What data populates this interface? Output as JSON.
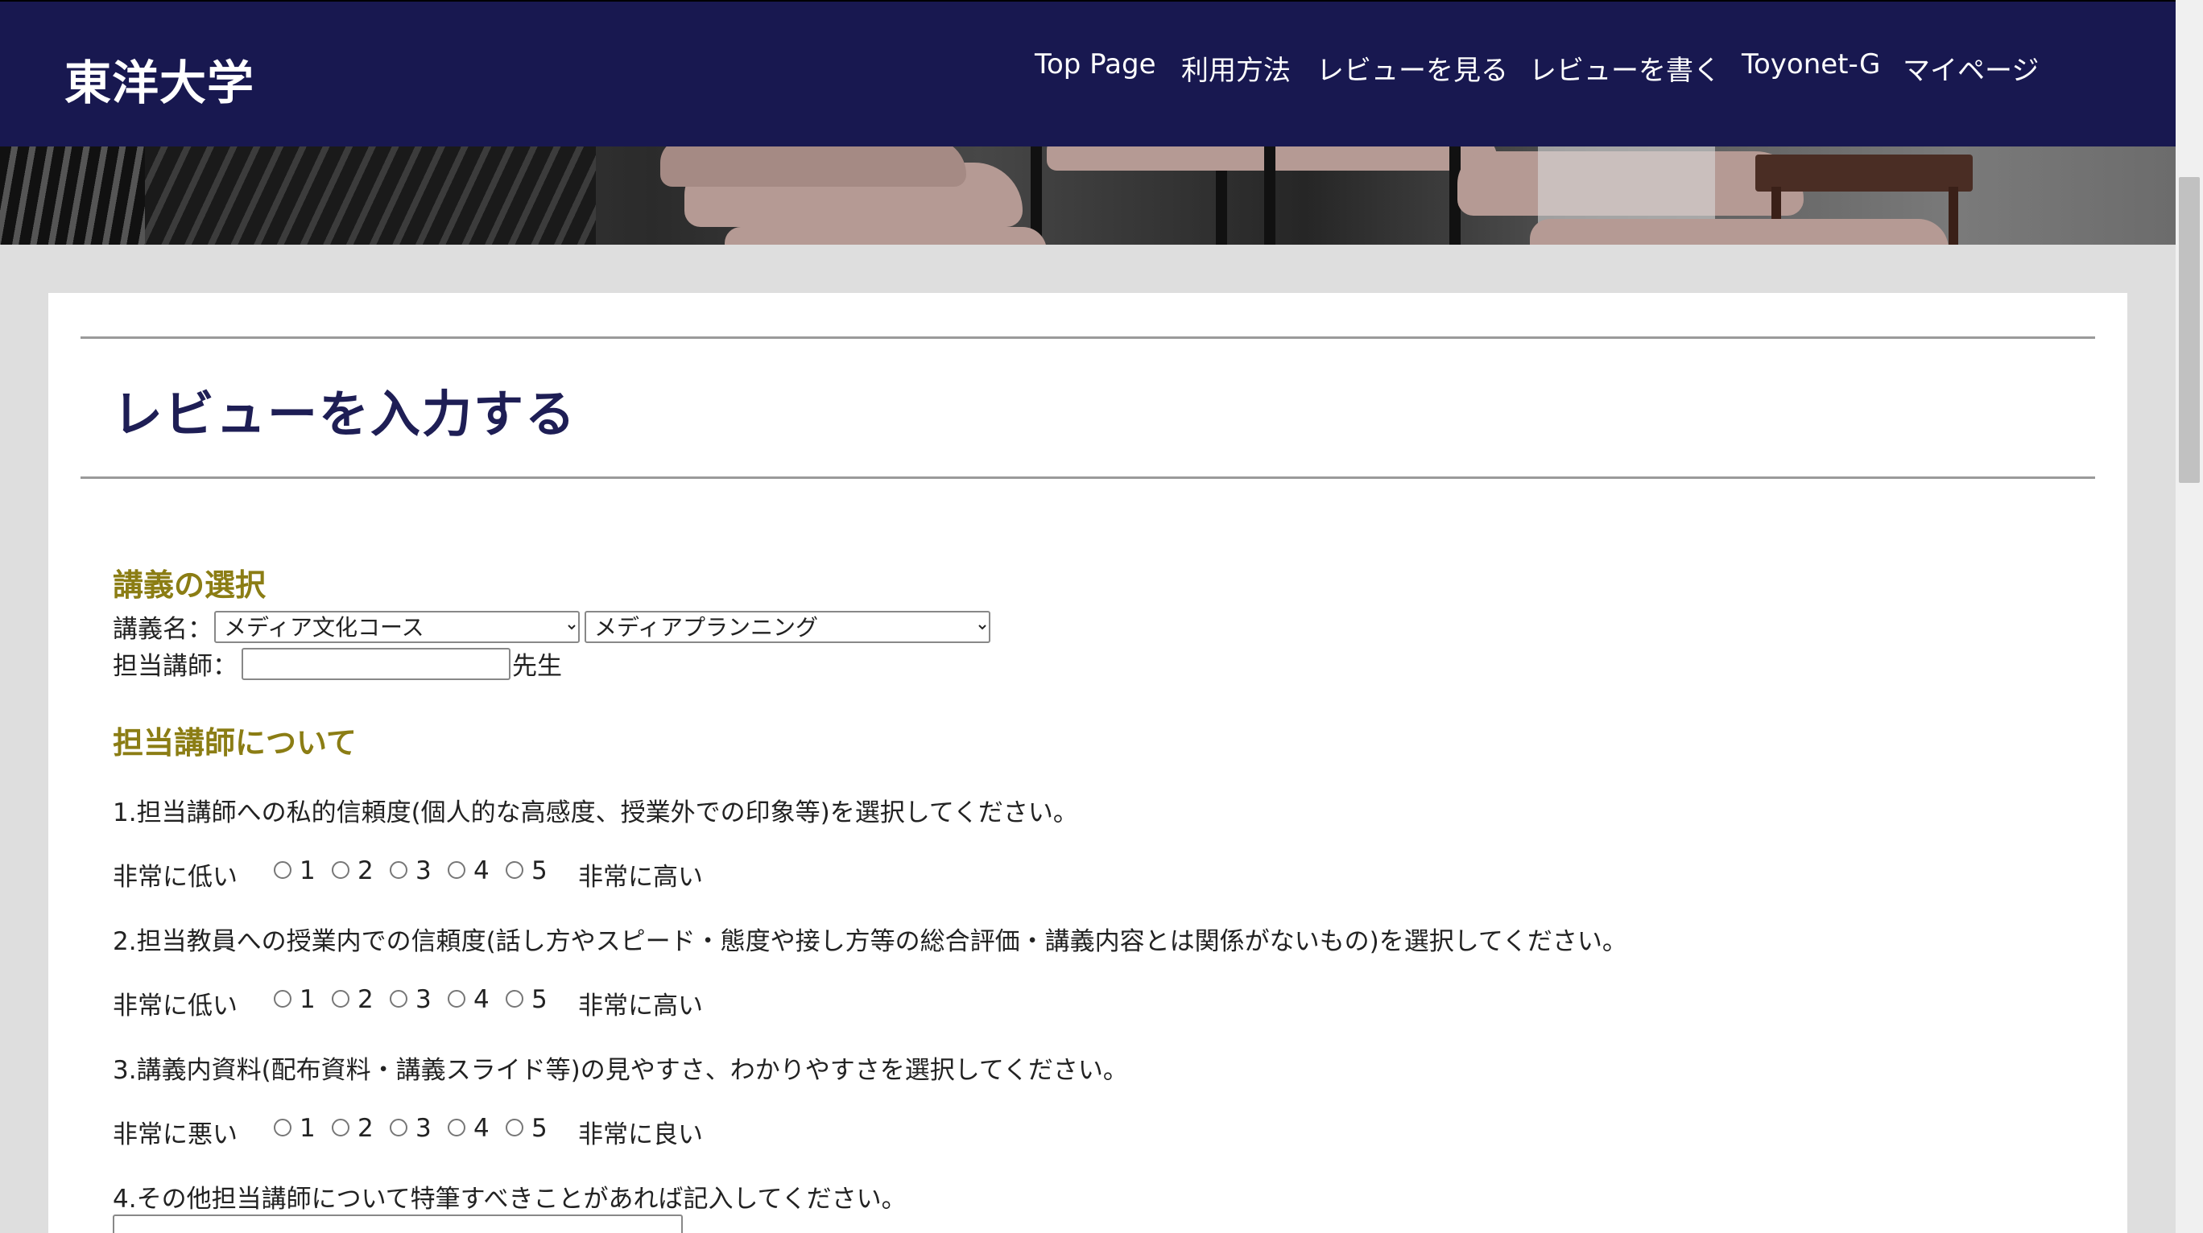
{
  "header": {
    "brand": "東洋大学",
    "nav": [
      {
        "label": "Top Page"
      },
      {
        "label": "利用方法"
      },
      {
        "label": "レビューを見る"
      },
      {
        "label": "レビューを書く"
      },
      {
        "label": "Toyonet-G"
      },
      {
        "label": "マイページ"
      }
    ]
  },
  "page": {
    "title": "レビューを入力する"
  },
  "lecture_select": {
    "heading": "講義の選択",
    "name_label": "講義名：",
    "course_value": "メディア文化コース",
    "lecture_value": "メディアプランニング",
    "instructor_label": "担当講師：",
    "instructor_value": "",
    "instructor_suffix": "先生"
  },
  "instructor_section": {
    "heading": "担当講師について",
    "questions": [
      {
        "text": "1.担当講師への私的信頼度(個人的な高感度、授業外での印象等)を選択してください。",
        "low": "非常に低い",
        "high": "非常に高い",
        "options": [
          "1",
          "2",
          "3",
          "4",
          "5"
        ]
      },
      {
        "text": "2.担当教員への授業内での信頼度(話し方やスピード・態度や接し方等の総合評価・講義内容とは関係がないもの)を選択してください。",
        "low": "非常に低い",
        "high": "非常に高い",
        "options": [
          "1",
          "2",
          "3",
          "4",
          "5"
        ]
      },
      {
        "text": "3.講義内資料(配布資料・講義スライド等)の見やすさ、わかりやすさを選択してください。",
        "low": "非常に悪い",
        "high": "非常に良い",
        "options": [
          "1",
          "2",
          "3",
          "4",
          "5"
        ]
      }
    ],
    "q4_text": "4.その他担当講師について特筆すべきことがあれば記入してください。",
    "q4_value": ""
  }
}
